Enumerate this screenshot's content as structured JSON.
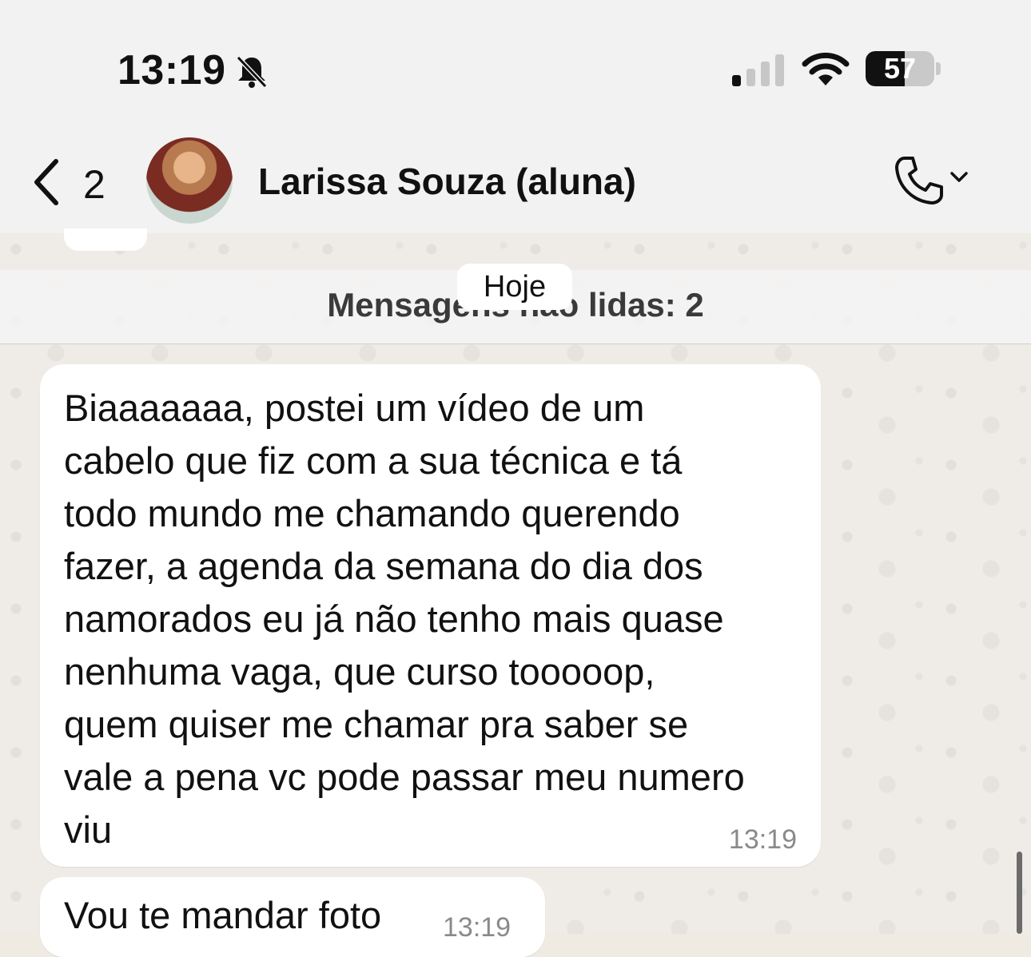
{
  "status_bar": {
    "time": "13:19",
    "battery_percent": "57",
    "battery_level": 0.57,
    "icons": [
      "bell-slash-icon",
      "signal-icon",
      "wifi-icon",
      "battery-icon"
    ]
  },
  "header": {
    "back_count": "2",
    "contact_name": "Larissa Souza (aluna)",
    "icons": [
      "chevron-left-icon",
      "phone-icon",
      "chevron-down-icon"
    ]
  },
  "chat": {
    "unread_banner": "Mensagens não lidas: 2",
    "date_chip": "Hoje",
    "messages": [
      {
        "text": "Biaaaaaaa, postei um vídeo de um\ncabelo que fiz com a sua técnica e tá\ntodo mundo me chamando querendo\nfazer, a agenda da semana do dia dos\nnamorados eu já não tenho mais quase\nnenhuma vaga, que curso tooooop,\nquem quiser me chamar pra saber se\nvale a pena vc pode passar meu numero\nviu",
        "time": "13:19"
      },
      {
        "text": "Vou te mandar foto",
        "time": "13:19"
      }
    ]
  },
  "colors": {
    "background": "#efeae2",
    "bubble": "#ffffff",
    "bar": "#f2f2f2"
  }
}
